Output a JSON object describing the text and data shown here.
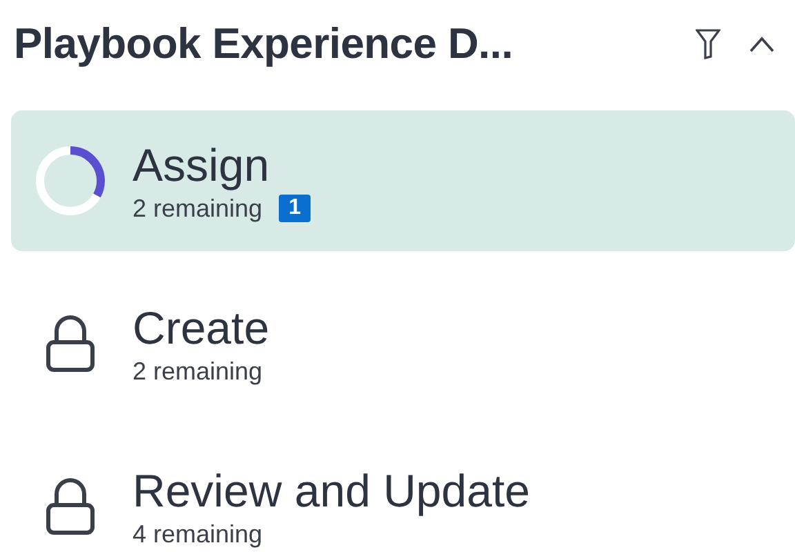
{
  "header": {
    "title": "Playbook Experience D..."
  },
  "steps": [
    {
      "kind": "progress",
      "label": "Assign",
      "remaining": "2 remaining",
      "badge": "1",
      "selected": true,
      "level": 0.33
    },
    {
      "kind": "locked",
      "label": "Create",
      "remaining": "2 remaining",
      "selected": false
    },
    {
      "kind": "locked",
      "label": "Review and Update",
      "remaining": "4 remaining",
      "selected": false
    }
  ]
}
